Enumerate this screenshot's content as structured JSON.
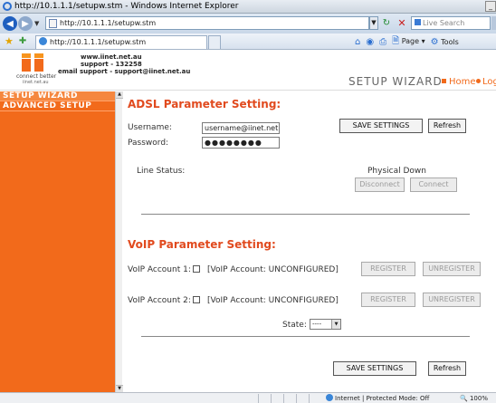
{
  "browser": {
    "title": "http://10.1.1.1/setupw.stm - Windows Internet Explorer",
    "address": "http://10.1.1.1/setupw.stm",
    "search_placeholder": "Live Search",
    "tab_label": "http://10.1.1.1/setupw.stm",
    "page_menu": "Page",
    "tools_menu": "Tools",
    "status_zone": "Internet | Protected Mode: Off",
    "zoom": "100%"
  },
  "header": {
    "website": "www.iinet.net.au",
    "support": "support - 132258",
    "email": "email support - support@iinet.net.au",
    "tagline": "connect better",
    "logo_url": "iinet.net.au",
    "title": "SETUP WIZARD",
    "home": "Home",
    "logout": "Log"
  },
  "sidebar": {
    "items": [
      {
        "label": "SETUP WIZARD"
      },
      {
        "label": "ADVANCED SETUP"
      }
    ]
  },
  "adsl": {
    "title": "ADSL Parameter Setting:",
    "username_label": "Username:",
    "username_value": "username@iinet.net.au",
    "password_label": "Password:",
    "password_value": "●●●●●●●●",
    "save_button": "SAVE SETTINGS",
    "refresh_button": "Refresh",
    "line_status_label": "Line Status:",
    "line_status_value": "Physical Down",
    "disconnect_button": "Disconnect",
    "connect_button": "Connect"
  },
  "voip": {
    "title": "VoIP Parameter Setting:",
    "accounts": [
      {
        "label": "VoIP Account 1:",
        "status": "[VoIP Account: UNCONFIGURED]",
        "register": "REGISTER",
        "unregister": "UNREGISTER"
      },
      {
        "label": "VoIP Account 2:",
        "status": "[VoIP Account: UNCONFIGURED]",
        "register": "REGISTER",
        "unregister": "UNREGISTER"
      }
    ],
    "state_label": "State:",
    "state_value": "----",
    "save_button": "SAVE SETTINGS",
    "refresh_button": "Refresh"
  },
  "colors": {
    "accent": "#f26a1b",
    "section_title": "#e14a1e"
  }
}
